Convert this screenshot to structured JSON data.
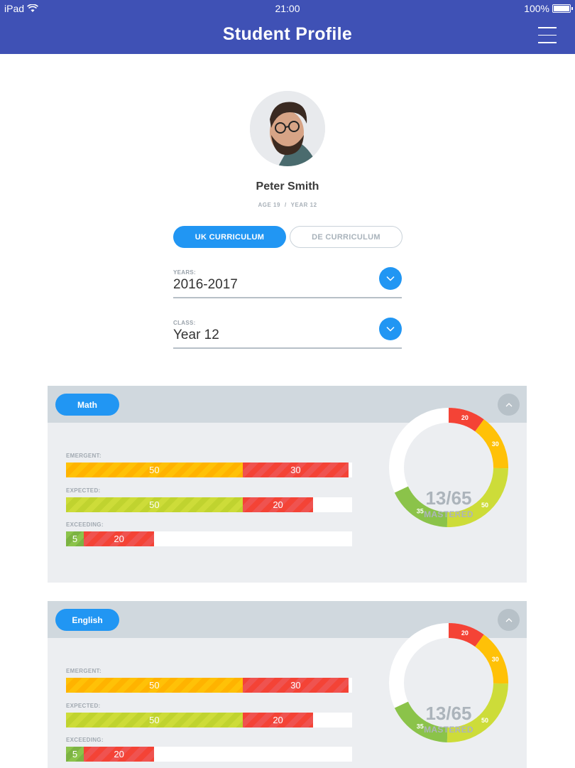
{
  "status_bar": {
    "carrier": "iPad",
    "time": "21:00",
    "battery": "100%"
  },
  "header": {
    "title": "Student Profile"
  },
  "profile": {
    "name": "Peter Smith",
    "age": "AGE 19",
    "separator": "/",
    "year": "YEAR 12"
  },
  "curriculum_tabs": {
    "active": "UK CURRICULUM",
    "inactive": "DE CURRICULUM"
  },
  "years_field": {
    "label": "YEARS:",
    "value": "2016-2017"
  },
  "class_field": {
    "label": "CLASS:",
    "value": "Year 12"
  },
  "colors": {
    "accent": "#2196f3",
    "header": "#3f51b5",
    "yellow": "#ffc107",
    "red": "#f44336",
    "lime": "#cddc39",
    "green": "#8bc34a"
  },
  "subjects": [
    {
      "name": "Math",
      "bars": [
        {
          "label": "EMERGENT:",
          "segments": [
            {
              "value": "50",
              "color": "yellow"
            },
            {
              "value": "30",
              "color": "red"
            }
          ]
        },
        {
          "label": "EXPECTED:",
          "segments": [
            {
              "value": "50",
              "color": "lime"
            },
            {
              "value": "20",
              "color": "red"
            }
          ]
        },
        {
          "label": "EXCEEDING:",
          "segments": [
            {
              "value": "5",
              "color": "green"
            },
            {
              "value": "20",
              "color": "red"
            }
          ]
        }
      ],
      "donut": {
        "mastered": "13/65",
        "caption": "MASTERED",
        "slices": [
          {
            "value": 20,
            "label": "20",
            "color": "red"
          },
          {
            "value": 30,
            "label": "30",
            "color": "yellow"
          },
          {
            "value": 50,
            "label": "50",
            "color": "lime"
          },
          {
            "value": 35,
            "label": "35",
            "color": "green"
          }
        ]
      }
    },
    {
      "name": "English",
      "bars": [
        {
          "label": "EMERGENT:",
          "segments": [
            {
              "value": "50",
              "color": "yellow"
            },
            {
              "value": "30",
              "color": "red"
            }
          ]
        },
        {
          "label": "EXPECTED:",
          "segments": [
            {
              "value": "50",
              "color": "lime"
            },
            {
              "value": "20",
              "color": "red"
            }
          ]
        },
        {
          "label": "EXCEEDING:",
          "segments": [
            {
              "value": "5",
              "color": "green"
            },
            {
              "value": "20",
              "color": "red"
            }
          ]
        }
      ],
      "donut": {
        "mastered": "13/65",
        "caption": "MASTERED",
        "slices": [
          {
            "value": 20,
            "label": "20",
            "color": "red"
          },
          {
            "value": 30,
            "label": "30",
            "color": "yellow"
          },
          {
            "value": 50,
            "label": "50",
            "color": "lime"
          },
          {
            "value": 35,
            "label": "35",
            "color": "green"
          }
        ]
      }
    }
  ]
}
